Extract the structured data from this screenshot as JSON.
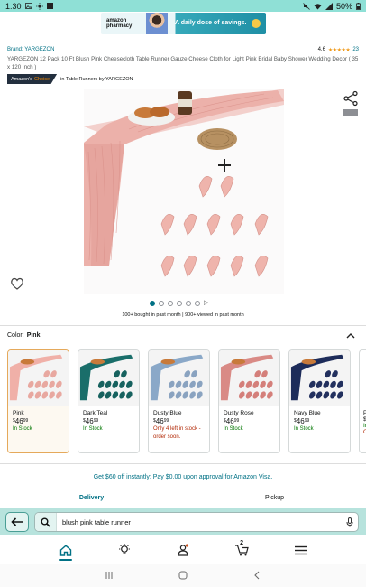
{
  "status_bar": {
    "time": "1:30",
    "battery": "50%",
    "left_icons": [
      "photo-icon",
      "brightness-icon",
      "grid-icon"
    ],
    "right_icons": [
      "mute-icon",
      "wifi-icon",
      "signal-icon",
      "battery-icon"
    ]
  },
  "ad_banner": {
    "brand": "amazon pharmacy",
    "tagline": "A daily dose of savings."
  },
  "product": {
    "brand": "Brand: YARGEZON",
    "rating": "4.6",
    "stars": "★★★★★",
    "rating_count": "23",
    "title": "YARGEZON 12 Pack 10 Ft Blush Pink Cheesecloth Table Runner Gauze Cheese Cloth for Light Pink Bridal Baby Shower Wedding Decor ( 35 x 120 Inch )",
    "badge": {
      "label_part1": "Amazon's",
      "label_part2": "Choice",
      "context": "in Table Runners by YARGEZON"
    },
    "bought": "100+ bought in past month  |  900+ viewed in past month",
    "image_dots": 6,
    "active_dot": 0
  },
  "color_selector": {
    "label": "Color:",
    "selected": "Pink",
    "options": [
      {
        "name": "Pink",
        "price_symbol": "$",
        "price_whole": "46",
        "price_fraction": "99",
        "stock": "In Stock",
        "low": false,
        "cloth": "#f0b0a8",
        "bundle": "#e8a8a0"
      },
      {
        "name": "Dark Teal",
        "price_symbol": "$",
        "price_whole": "46",
        "price_fraction": "99",
        "stock": "In Stock",
        "low": false,
        "cloth": "#1a6e6a",
        "bundle": "#17625f"
      },
      {
        "name": "Dusty Blue",
        "price_symbol": "$",
        "price_whole": "46",
        "price_fraction": "99",
        "stock": "Only 4 left in stock - order soon.",
        "low": true,
        "cloth": "#8aa8c8",
        "bundle": "#8aa3c0"
      },
      {
        "name": "Dusty Rose",
        "price_symbol": "$",
        "price_whole": "46",
        "price_fraction": "99",
        "stock": "In Stock",
        "low": false,
        "cloth": "#d98a85",
        "bundle": "#d47f7a"
      },
      {
        "name": "Navy Blue",
        "price_symbol": "$",
        "price_whole": "46",
        "price_fraction": "99",
        "stock": "In Stock",
        "low": false,
        "cloth": "#1d2c5a",
        "bundle": "#22305e"
      }
    ],
    "partial_option": {
      "name": "Pu",
      "price": "$4",
      "stock": "In",
      "low_line": "Or"
    }
  },
  "offer": "Get $60 off instantly: Pay $0.00 upon approval for Amazon Visa.",
  "tabs": [
    "Delivery",
    "Pickup"
  ],
  "search": {
    "value": "blush pink table runner"
  },
  "bottom_nav": {
    "cart_count": "2"
  },
  "colors": {
    "accent": "#007185",
    "dock": "#b7e3dd",
    "star": "#f09a1a",
    "stock_green": "#007600",
    "stock_red": "#b12704"
  }
}
